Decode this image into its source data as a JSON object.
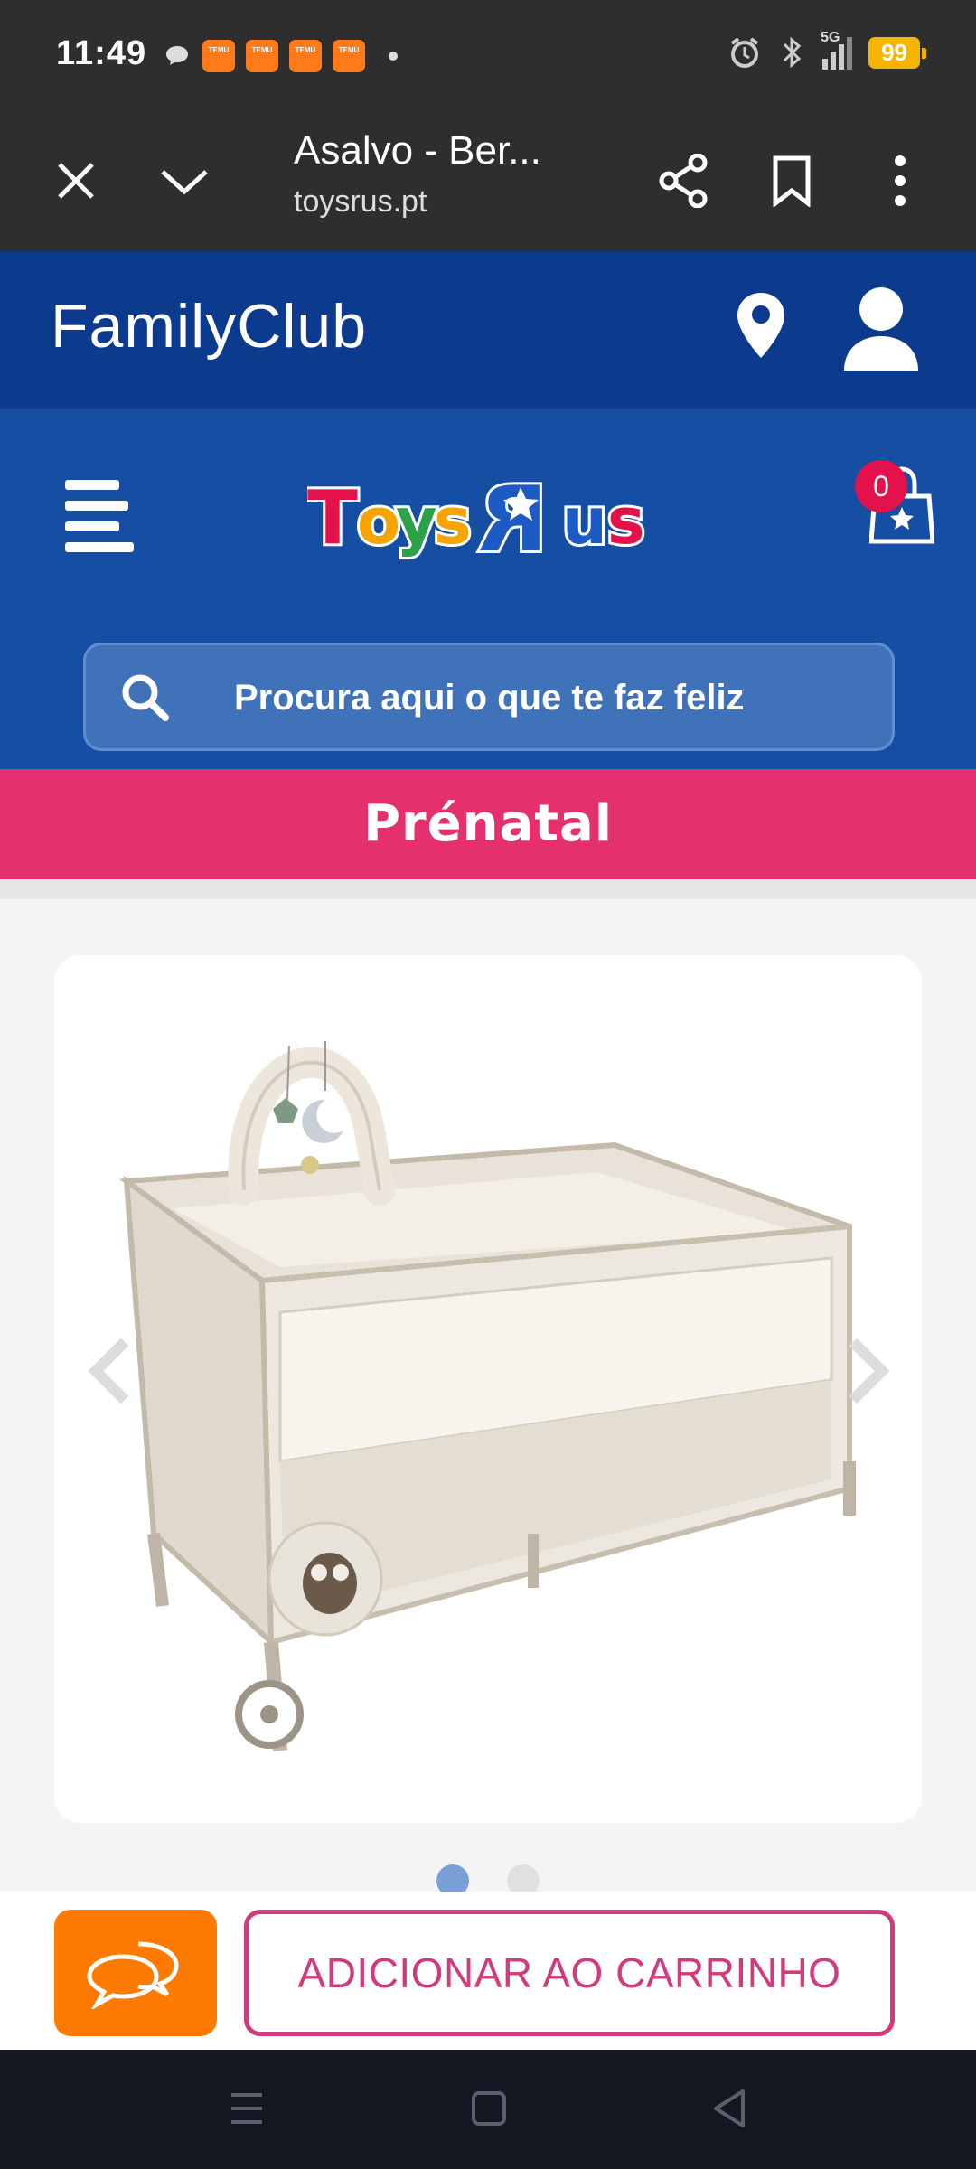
{
  "status_bar": {
    "time": "11:49",
    "notification_icons": [
      "TEMU",
      "TEMU",
      "TEMU",
      "TEMU"
    ],
    "network": "5G",
    "battery": "99"
  },
  "browser": {
    "page_title": "Asalvo - Ber...",
    "url": "toysrus.pt"
  },
  "family_club": {
    "logo_text": "FamilyClub"
  },
  "header": {
    "logo_text": "ToysRus",
    "cart_count": "0",
    "search_placeholder": "Procura aqui o que te faz feliz"
  },
  "prenatal": {
    "logo_text": "Prénatal"
  },
  "gallery": {
    "image_count": 2,
    "active_index": 0,
    "image_subject": "travel-cot"
  },
  "actions": {
    "add_to_cart_label": "ADICIONAR AO CARRINHO"
  },
  "colors": {
    "family_bar": "#0c3a8d",
    "header": "#154ea3",
    "prenatal": "#e4306f",
    "chat_button": "#ff7a00",
    "add_to_cart_border": "#d13b7e"
  }
}
